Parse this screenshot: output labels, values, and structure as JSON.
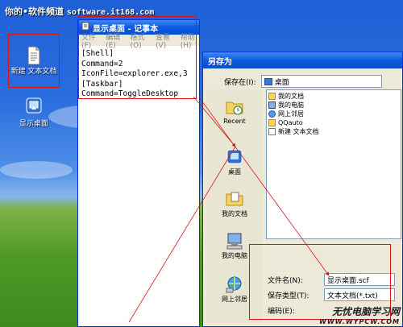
{
  "watermark_top": {
    "prefix": "你的",
    "channel": "软件频道",
    "url": "software.it168.com"
  },
  "desktop": {
    "icons": [
      {
        "label": "新建 文本文档"
      },
      {
        "label": "显示桌面"
      }
    ]
  },
  "notepad": {
    "title": "显示桌面 - 记事本",
    "menu": [
      "文件(F)",
      "编辑(E)",
      "格式(O)",
      "查看(V)",
      "帮助(H)"
    ],
    "lines": [
      "[Shell]",
      "Command=2",
      "IconFile=explorer.exe,3",
      "[Taskbar]",
      "Command=ToggleDesktop"
    ]
  },
  "saveas": {
    "title": "另存为",
    "save_in_label": "保存在(I):",
    "save_in_value": "桌面",
    "places": [
      "Recent",
      "桌面",
      "我的文档",
      "我的电脑",
      "网上邻居"
    ],
    "files": [
      "我的文档",
      "我的电脑",
      "网上邻居",
      "QQauto",
      "新建 文本文档"
    ],
    "filename_label": "文件名(N):",
    "filename_value": "显示桌面.scf",
    "filetype_label": "保存类型(T):",
    "filetype_value": "文本文档(*.txt)",
    "encoding_label": "编码(E):"
  },
  "watermark_bottom": {
    "title": "无忧电脑学习网",
    "url": "WWW.WYPCW.COM"
  },
  "colors": {
    "annotation": "#e01010",
    "titlebar": "#0c59e0"
  }
}
